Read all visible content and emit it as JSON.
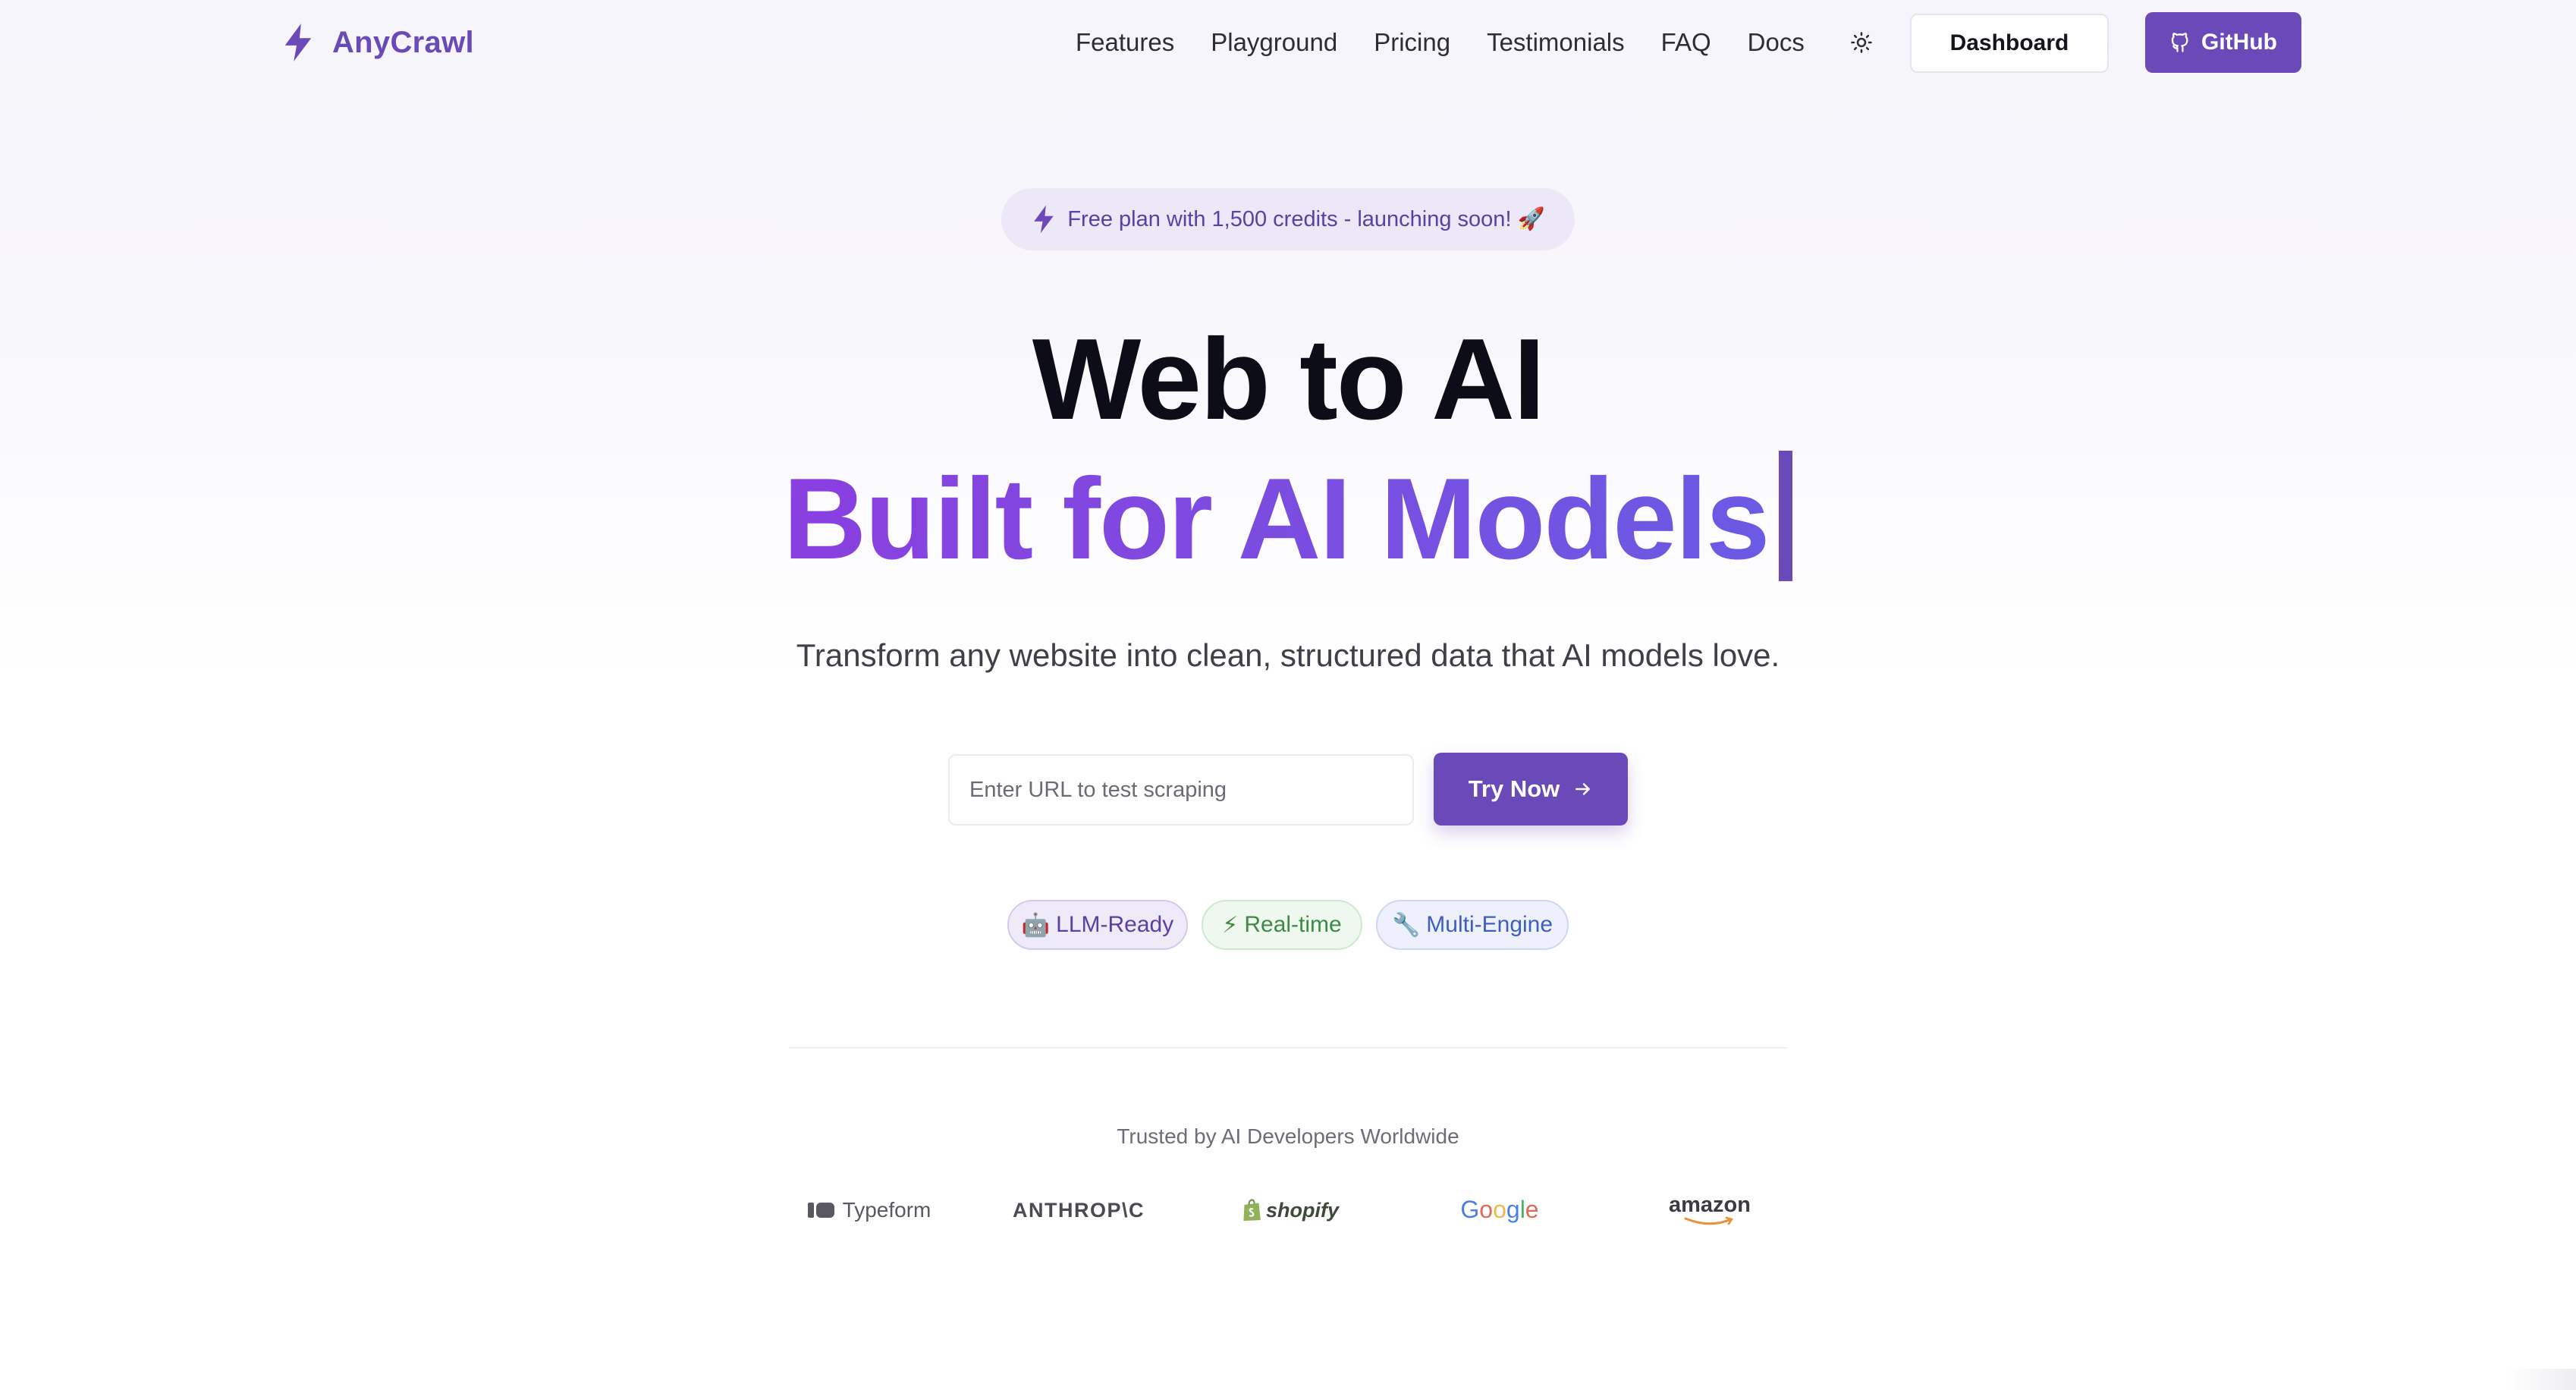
{
  "brand": {
    "name": "AnyCrawl"
  },
  "nav": {
    "links": [
      "Features",
      "Playground",
      "Pricing",
      "Testimonials",
      "FAQ",
      "Docs"
    ],
    "dashboard_label": "Dashboard",
    "github_label": "GitHub"
  },
  "hero": {
    "promo": "Free plan with 1,500 credits - launching soon! 🚀",
    "title": "Web to AI",
    "subtitle": "Built for AI Models",
    "tagline": "Transform any website into clean, structured data that AI models love.",
    "url_placeholder": "Enter URL to test scraping",
    "try_label": "Try Now"
  },
  "features": [
    {
      "icon": "🤖",
      "label": "LLM-Ready"
    },
    {
      "icon": "⚡",
      "label": "Real-time"
    },
    {
      "icon": "🔧",
      "label": "Multi-Engine"
    }
  ],
  "trusted": {
    "heading": "Trusted by AI Developers Worldwide",
    "logos": [
      "Typeform",
      "ANTHROP\\C",
      "shopify",
      "Google",
      "amazon"
    ]
  },
  "colors": {
    "accent": "#6a49b8",
    "gradient_start": "#8a3fe0",
    "gradient_end": "#6a5ae4"
  }
}
